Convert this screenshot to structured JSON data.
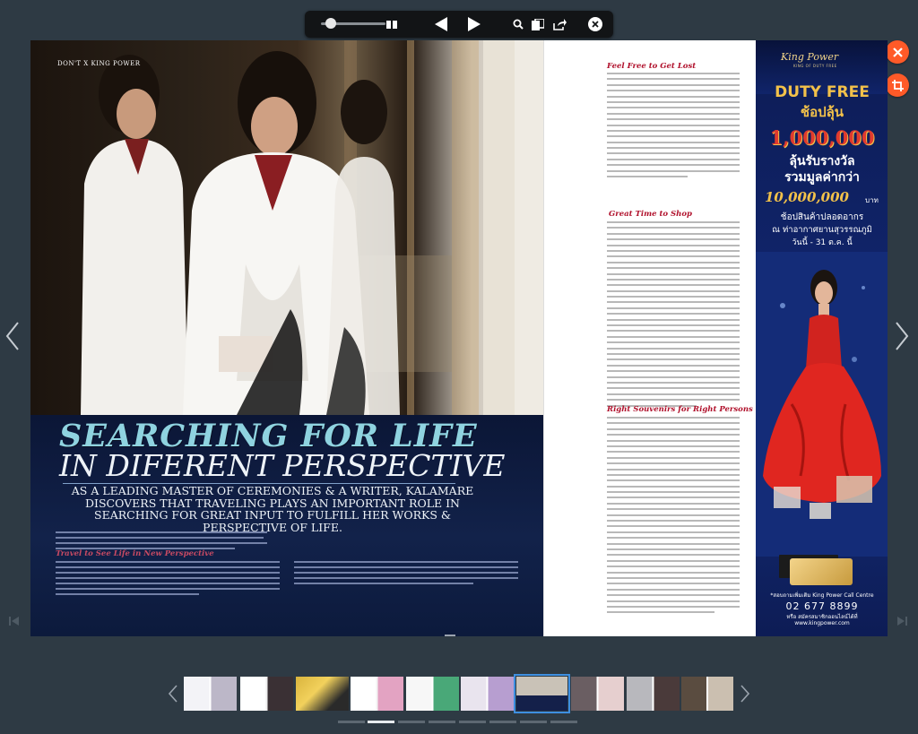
{
  "toolbar": {
    "zoom_level": 0.1,
    "icons": [
      "slider",
      "spread-view-icon",
      "prev-arrow-icon",
      "next-arrow-icon",
      "search-icon",
      "bookmark-icon",
      "share-icon",
      "close-icon"
    ]
  },
  "left_page": {
    "running_head": "DON'T X KING POWER",
    "headline_line1": "SEARCHING FOR LIFE",
    "headline_line2": "IN DIFERENT PERSPECTIVE",
    "deck": "AS A LEADING MASTER OF CEREMONIES & A WRITER, KALAMARE DISCOVERS THAT TRAVELING PLAYS AN IMPORTANT ROLE IN SEARCHING FOR GREAT INPUT TO FULFILL HER WORKS & PERSPECTIVE OF LIFE.",
    "subhead": "Travel to See Life in New Perspective"
  },
  "article": {
    "sections": [
      {
        "heading": "Feel Free to Get Lost"
      },
      {
        "heading": "Great Time to Shop"
      },
      {
        "heading": "Right Souvenirs for Right Persons"
      }
    ]
  },
  "ad": {
    "brand": "King Power",
    "brand_tag": "KING OF DUTY FREE",
    "title": "DUTY FREE",
    "title_th": "ช้อปลุ้น",
    "prize_total": "1,000,000",
    "line1": "ลุ้นรับรางวัล",
    "line2": "รวมมูลค่ากว่า",
    "amount": "10,000,000",
    "amount_unit": "บาท",
    "venue": "ช้อปสินค้าปลอดอากร",
    "venue2": "ณ ท่าอากาศยานสุวรรณภูมิ",
    "date": "วันนี้ - 31 ต.ค. นี้",
    "call_center_label": "*สอบถามเพิ่มเติม King Power Call Centre",
    "phone": "02 677 8899",
    "website": "หรือ สมัครสมาชิกออนไลน์ได้ที่ www.kingpower.com"
  },
  "thumbnails": {
    "count": 10,
    "active_index": 6
  },
  "pagination": {
    "count": 8,
    "active_index": 1
  },
  "colors": {
    "accent": "#ff5a28",
    "headline": "#8fd3e0",
    "subhead_red": "#b0102b",
    "ad_gold": "#f2c14a"
  }
}
